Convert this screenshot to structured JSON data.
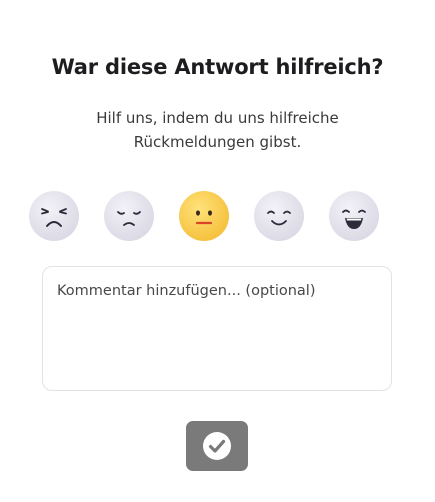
{
  "dialog": {
    "title": "War diese Antwort hilfreich?",
    "subtitle": "Hilf uns, indem du uns hilfreiche Rückmeldungen gibst."
  },
  "rating": {
    "options": [
      {
        "name": "angry-face-icon",
        "selected": false
      },
      {
        "name": "sad-face-icon",
        "selected": false
      },
      {
        "name": "neutral-face-icon",
        "selected": true
      },
      {
        "name": "smiling-face-icon",
        "selected": false
      },
      {
        "name": "laughing-face-icon",
        "selected": false
      }
    ],
    "selected_index": 2
  },
  "comment": {
    "placeholder": "Kommentar hinzufügen... (optional)",
    "value": ""
  },
  "submit": {
    "icon": "check-circle-icon"
  },
  "colors": {
    "accent_selected": "#f7c948",
    "face_inactive": "#e4e3ee",
    "submit_button": "#7a7a7a",
    "title_text": "#1d1d1f"
  }
}
